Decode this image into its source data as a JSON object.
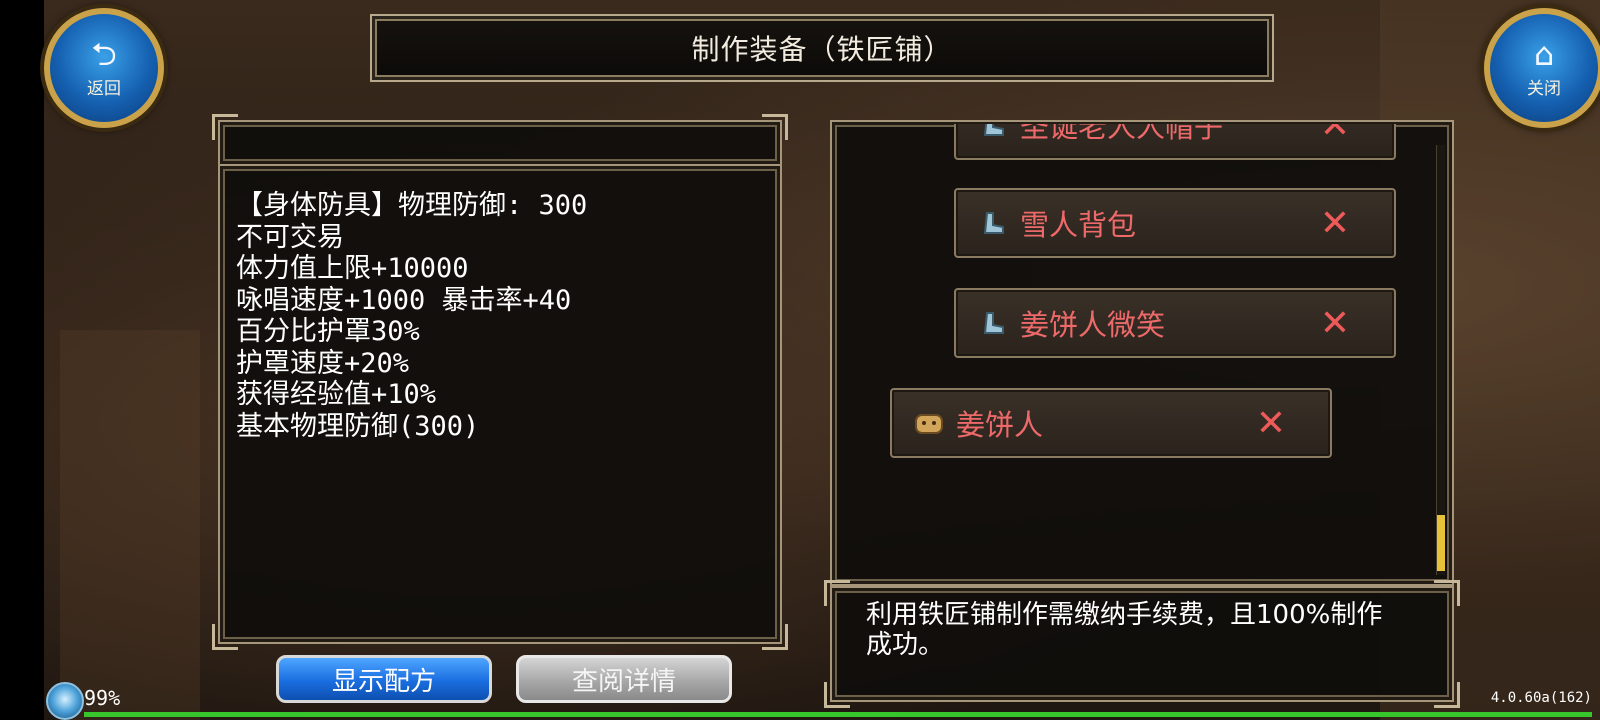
{
  "window": {
    "title": "制作装备（铁匠铺）"
  },
  "nav": {
    "back": {
      "label": "返回",
      "icon": "back-arrow-icon"
    },
    "close": {
      "label": "关闭",
      "icon": "home-icon"
    }
  },
  "item_detail": {
    "lines": [
      "【身体防具】物理防御: 300",
      "不可交易",
      "体力值上限+10000",
      "咏唱速度+1000 暴击率+40",
      "百分比护罩30%",
      "护罩速度+20%",
      "获得经验值+10%",
      "基本物理防御(300)"
    ]
  },
  "recipes": [
    {
      "name": "圣诞老人人帽子",
      "icon": "boot-icon",
      "remove": "✕"
    },
    {
      "name": "雪人背包",
      "icon": "boot-icon",
      "remove": "✕"
    },
    {
      "name": "姜饼人微笑",
      "icon": "boot-icon",
      "remove": "✕"
    },
    {
      "name": "姜饼人",
      "icon": "gingerbread-icon",
      "remove": "✕"
    }
  ],
  "notice": "利用铁匠铺制作需缴纳手续费，且100%制作成功。",
  "buttons": {
    "show_recipe": "显示配方",
    "view_details": "查阅详情"
  },
  "status": {
    "battery": "99%",
    "progress_fraction": 1.0,
    "version": "4.0.60a(162)"
  },
  "colors": {
    "recipe_text": "#ee6a6a",
    "accent_blue": "#1a6ee0",
    "frame_gold": "#c9a24a"
  }
}
